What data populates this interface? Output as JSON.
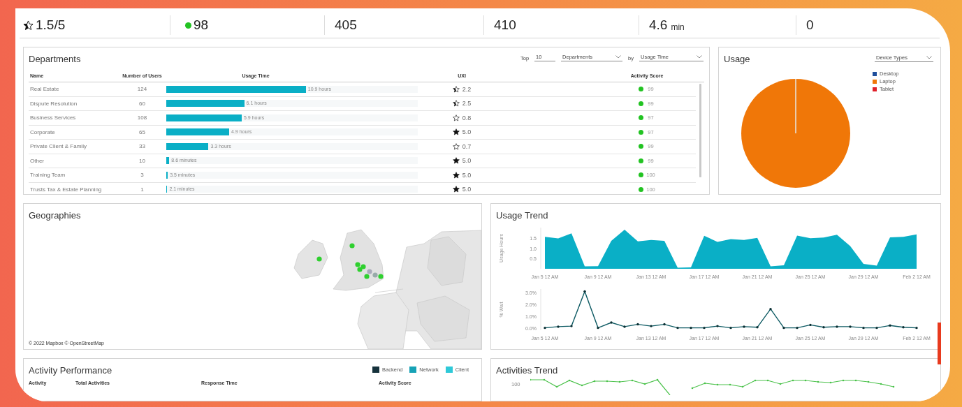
{
  "kpis": [
    {
      "kind": "halfstar",
      "value": "1.5/5"
    },
    {
      "kind": "dot",
      "color": "#22c322",
      "value": "98"
    },
    {
      "kind": "plain",
      "value": "405"
    },
    {
      "kind": "plain",
      "value": "410"
    },
    {
      "kind": "unit",
      "value": "4.6",
      "unit": "min"
    },
    {
      "kind": "plain",
      "value": "0"
    }
  ],
  "departments": {
    "title": "Departments",
    "controls": {
      "top_label": "Top",
      "top_value": "10",
      "group_by": "Departments",
      "by_label": "by",
      "sort_by": "Usage Time"
    },
    "columns": [
      "Name",
      "Number of Users",
      "Usage Time",
      "UXI",
      "Activity Score"
    ],
    "rows": [
      {
        "name": "Real Estate",
        "users": "124",
        "level": 0.555,
        "usage": "10.9 hours",
        "kind": "half",
        "uxi": "2.2",
        "color": "#22c322",
        "score": "99"
      },
      {
        "name": "Dispute Resolution",
        "users": "60",
        "level": 0.31,
        "usage": "6.1 hours",
        "kind": "half",
        "uxi": "2.5",
        "color": "#22c322",
        "score": "99"
      },
      {
        "name": "Business Services",
        "users": "108",
        "level": 0.3,
        "usage": "5.9 hours",
        "kind": "empty",
        "uxi": "0.8",
        "color": "#22c322",
        "score": "97"
      },
      {
        "name": "Corporate",
        "users": "65",
        "level": 0.25,
        "usage": "4.9 hours",
        "kind": "full",
        "uxi": "5.0",
        "color": "#22c322",
        "score": "97"
      },
      {
        "name": "Private Client & Family",
        "users": "33",
        "level": 0.168,
        "usage": "3.3 hours",
        "kind": "empty",
        "uxi": "0.7",
        "color": "#22c322",
        "score": "99"
      },
      {
        "name": "Other",
        "users": "10",
        "level": 0.012,
        "usage": "8.6 minutes",
        "kind": "full",
        "uxi": "5.0",
        "color": "#22c322",
        "score": "99"
      },
      {
        "name": "Training Team",
        "users": "3",
        "level": 0.006,
        "usage": "3.5 minutes",
        "kind": "full",
        "uxi": "5.0",
        "color": "#22c322",
        "score": "100"
      },
      {
        "name": "Trusts Tax & Estate Planning",
        "users": "1",
        "level": 0.004,
        "usage": "2.1 minutes",
        "kind": "full",
        "uxi": "5.0",
        "color": "#22c322",
        "score": "100"
      }
    ]
  },
  "usage": {
    "title": "Usage",
    "selector": "Device Types",
    "legend": [
      {
        "label": "Desktop",
        "color": "#1f4e9c"
      },
      {
        "label": "Laptop",
        "color": "#f07708"
      },
      {
        "label": "Tablet",
        "color": "#e0202a"
      }
    ]
  },
  "geographies": {
    "title": "Geographies",
    "attribution": "© 2022 Mapbox © OpenStreetMap"
  },
  "usage_trend": {
    "title": "Usage Trend",
    "hours_chart": {
      "chart_data": {
        "type": "area",
        "ylabel": "Usage Hours",
        "categories": [
          "Jan 5 12 AM",
          null,
          null,
          null,
          "Jan 9 12 AM",
          null,
          null,
          null,
          "Jan 13 12 AM",
          null,
          null,
          null,
          "Jan 17 12 AM",
          null,
          null,
          null,
          "Jan 21 12 AM",
          null,
          null,
          null,
          "Jan 25 12 AM",
          null,
          null,
          null,
          "Jan 29 12 AM",
          null,
          null,
          null,
          "Feb 2 12 AM"
        ],
        "yticks": [
          0.5,
          {
            "value": 1,
            "label": "1.0"
          },
          1.5
        ],
        "ylim": [
          0,
          2
        ],
        "series": [
          {
            "color": "#0aafc6",
            "values": [
              1.55,
              1.47,
              1.72,
              0.12,
              0.13,
              1.36,
              1.9,
              1.33,
              1.4,
              1.36,
              0.05,
              0.07,
              1.6,
              1.31,
              1.44,
              1.4,
              1.5,
              0.12,
              0.17,
              1.61,
              1.48,
              1.52,
              1.65,
              1.1,
              0.24,
              0.15,
              1.53,
              1.55,
              1.67
            ]
          }
        ]
      }
    },
    "wait_chart": {
      "chart_data": {
        "type": "line",
        "ylabel": "% Wait",
        "categories": [
          "Jan 5 12 AM",
          null,
          null,
          null,
          "Jan 9 12 AM",
          null,
          null,
          null,
          "Jan 13 12 AM",
          null,
          null,
          null,
          "Jan 17 12 AM",
          null,
          null,
          null,
          "Jan 21 12 AM",
          null,
          null,
          null,
          "Jan 25 12 AM",
          null,
          null,
          null,
          "Jan 29 12 AM",
          null,
          null,
          null,
          "Feb 2 12 AM"
        ],
        "yticks": [
          {
            "value": 0,
            "label": "0.0%"
          },
          {
            "value": 1,
            "label": "1.0%"
          },
          {
            "value": 2,
            "label": "2.0%"
          },
          {
            "value": 3,
            "label": "3.0%"
          }
        ],
        "ylim": [
          -0.2,
          3.3
        ],
        "series": [
          {
            "color": "#0d5a63",
            "values": [
              0.0,
              0.1,
              0.15,
              3.1,
              0.0,
              0.45,
              0.1,
              0.3,
              0.15,
              0.3,
              0.0,
              0.0,
              0.0,
              0.15,
              0.0,
              0.1,
              0.05,
              1.6,
              0.0,
              0.0,
              0.25,
              0.05,
              0.1,
              0.1,
              0.0,
              0.0,
              0.2,
              0.05,
              0.0
            ]
          }
        ]
      }
    }
  },
  "activity_performance": {
    "title": "Activity Performance",
    "legend": [
      {
        "label": "Backend",
        "color": "#16323c"
      },
      {
        "label": "Network",
        "color": "#16a2b6"
      },
      {
        "label": "Client",
        "color": "#2ec9d8"
      }
    ],
    "columns": [
      "Activity",
      "Total Activities",
      "Response Time",
      "Activity Score"
    ]
  },
  "activities_trend": {
    "title": "Activities Trend",
    "y_tick": "100"
  }
}
